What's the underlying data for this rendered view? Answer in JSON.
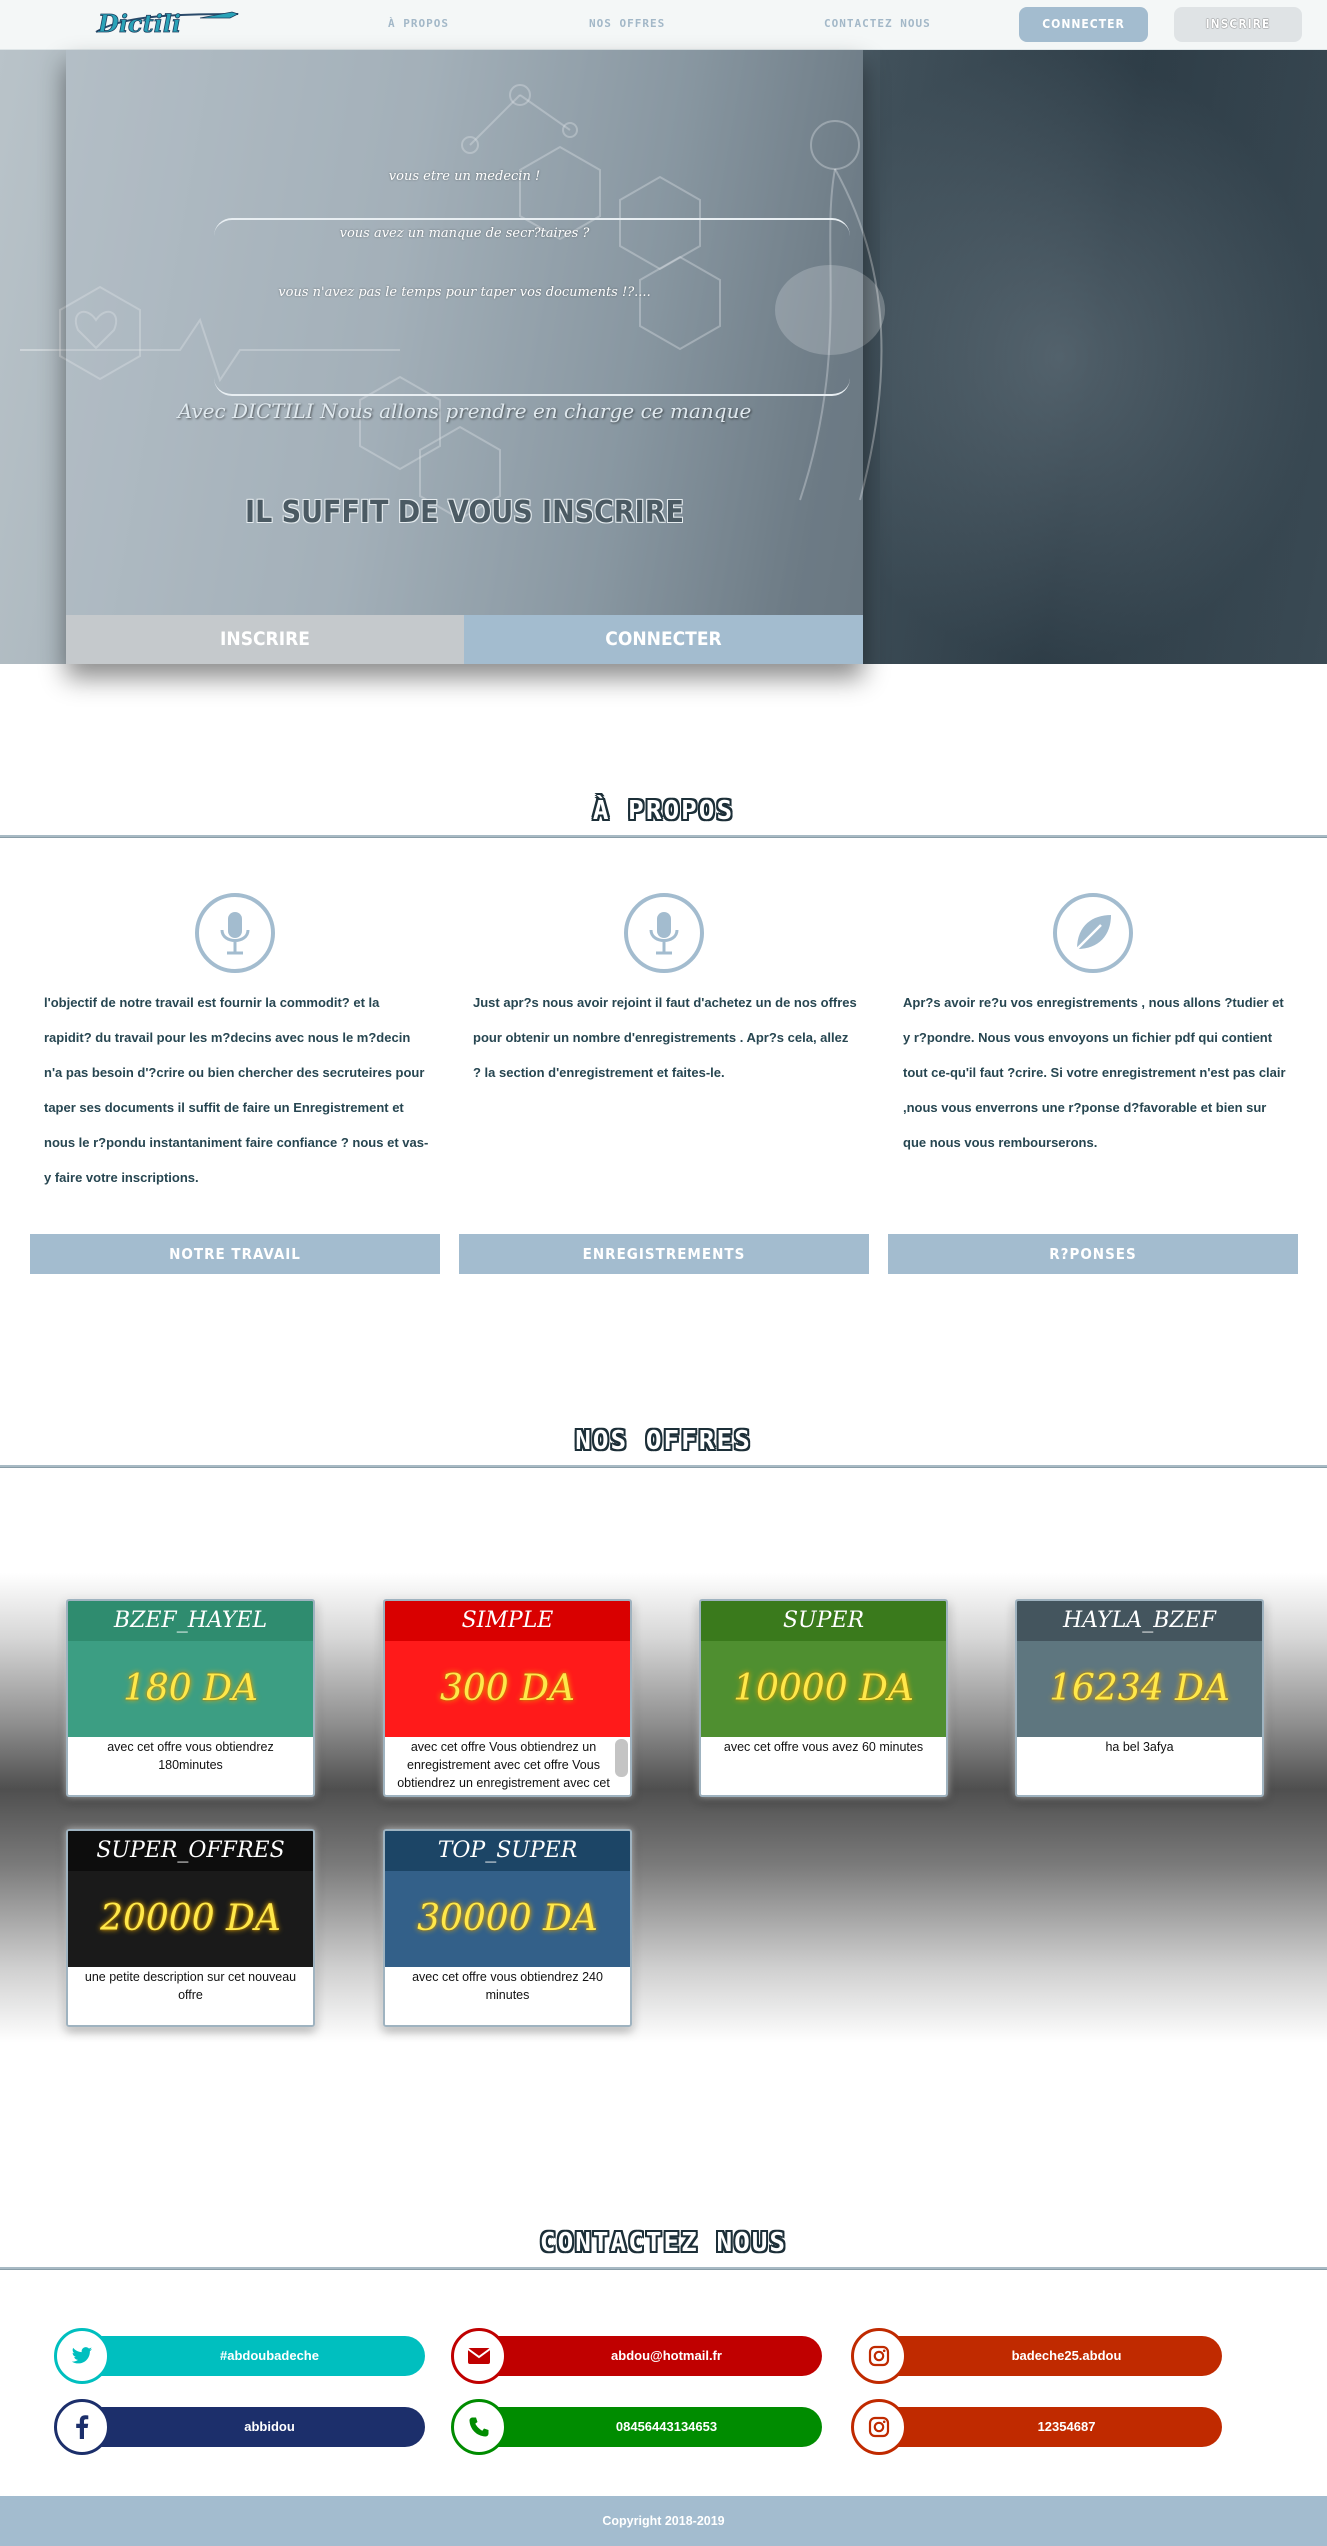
{
  "nav": {
    "logo_text": "Dictili",
    "links": [
      "À PROPOS",
      "NOS OFFRES",
      "CONTACTEZ NOUS"
    ],
    "connect_label": "CONNECTER",
    "signup_label": "INSCRIRE"
  },
  "hero": {
    "line1": "vous etre un medecin !",
    "line2": "vous avez un manque de secr?taires ?",
    "line3": "vous n'avez pas le temps pour taper vos documents !?....",
    "tagline": "Avec DICTILI Nous allons prendre en charge ce manque",
    "title": "IL SUFFIT DE VOUS INSCRIRE",
    "signup_label": "INSCRIRE",
    "connect_label": "CONNECTER"
  },
  "about": {
    "title": "À PROPOS",
    "columns": [
      {
        "icon": "microphone-icon",
        "text": "l'objectif de notre travail est fournir la commodit? et la rapidit? du travail pour les m?decins avec nous le m?decin n'a pas besoin d'?crire ou bien chercher des secruteires pour taper ses documents il suffit de faire un Enregistrement et nous le r?pondu instantaniment faire confiance ? nous et vas-y faire votre inscriptions.",
        "button": "NOTRE TRAVAIL"
      },
      {
        "icon": "microphone-icon",
        "text": "Just apr?s nous avoir rejoint il faut d'achetez un de nos offres pour obtenir un nombre d'enregistrements . Apr?s cela, allez ? la section d'enregistrement et faites-le.",
        "button": "ENREGISTREMENTS"
      },
      {
        "icon": "leaf-icon",
        "text": "Apr?s avoir re?u vos enregistrements , nous allons ?tudier et y r?pondre. Nous vous envoyons un fichier pdf qui contient tout ce-qu'il faut ?crire. Si votre enregistrement n'est pas clair ,nous vous enverrons une r?ponse d?favorable et bien sur que nous vous rembourserons.",
        "button": "R?PONSES"
      }
    ]
  },
  "offers": {
    "title": "NOS OFFRES",
    "items": [
      {
        "name": "BZEF_HAYEL",
        "price": "180 DA",
        "desc": "avec cet offre vous obtiendrez 180minutes",
        "head_color": "#2f8c6f",
        "body_color": "#3c9e83"
      },
      {
        "name": "SIMPLE",
        "price": "300 DA",
        "desc": "avec cet offre Vous obtiendrez un enregistrement avec cet offre Vous obtiendrez un enregistrement avec cet",
        "head_color": "#d90000",
        "body_color": "#ff1a1a"
      },
      {
        "name": "SUPER",
        "price": "10000 DA",
        "desc": "avec cet offre vous avez 60 minutes",
        "head_color": "#3a7a1c",
        "body_color": "#4f8f30"
      },
      {
        "name": "HAYLA_BZEF",
        "price": "16234 DA",
        "desc": "ha bel 3afya",
        "head_color": "#44555e",
        "body_color": "#5e767f"
      },
      {
        "name": "SUPER_OFFRES",
        "price": "20000 DA",
        "desc": "une petite description sur cet nouveau offre",
        "head_color": "#0d0d0d",
        "body_color": "#1a1a1a"
      },
      {
        "name": "TOP_SUPER",
        "price": "30000 DA",
        "desc": "avec cet offre vous obtiendrez 240 minutes",
        "head_color": "#1c4566",
        "body_color": "#336089"
      }
    ]
  },
  "contact": {
    "title": "CONTACTEZ NOUS",
    "items": [
      {
        "icon": "twitter-icon",
        "label": "#abdoubadeche",
        "color": "#00bfbf"
      },
      {
        "icon": "mail-icon",
        "label": "abdou@hotmail.fr",
        "color": "#c00000"
      },
      {
        "icon": "instagram-icon",
        "label": "badeche25.abdou",
        "color": "#c02a00"
      },
      {
        "icon": "facebook-icon",
        "label": "abbidou",
        "color": "#1c2f6b"
      },
      {
        "icon": "phone-icon",
        "label": "08456443134653",
        "color": "#008c00"
      },
      {
        "icon": "instagram-icon",
        "label": "12354687",
        "color": "#c02a00"
      }
    ]
  },
  "footer": {
    "copyright": "Copyright 2018-2019"
  }
}
